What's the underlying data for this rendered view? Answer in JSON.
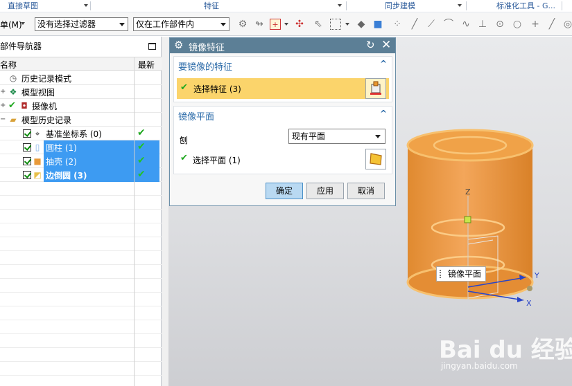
{
  "ribbon": {
    "groups": [
      "直接草图",
      "特征",
      "同步建模",
      "标准化工具 - G..."
    ]
  },
  "toolbar": {
    "menu_label": "单(M)",
    "filter_value": "没有选择过滤器",
    "scope_value": "仅在工作部件内"
  },
  "navigator": {
    "title": "部件导航器",
    "col_name": "名称",
    "col_latest": "最新",
    "rows": [
      {
        "label": "历史记录模式"
      },
      {
        "label": "模型视图"
      },
      {
        "label": "摄像机"
      },
      {
        "label": "模型历史记录"
      },
      {
        "label": "基准坐标系 (0)"
      },
      {
        "label": "圆柱 (1)"
      },
      {
        "label": "抽壳 (2)"
      },
      {
        "label": "边倒圆 (3)"
      }
    ]
  },
  "dialog": {
    "title": "镜像特征",
    "section_features": {
      "title": "要镜像的特征",
      "select_label": "选择特征 (3)"
    },
    "section_plane": {
      "title": "镜像平面",
      "orient_label": "刨",
      "plane_value": "现有平面",
      "select_label": "选择平面 (1)"
    },
    "buttons": {
      "ok": "确定",
      "apply": "应用",
      "cancel": "取消"
    }
  },
  "viewport": {
    "tooltip": "镜像平面",
    "axis_z": "Z",
    "axis_y": "Y",
    "axis_x": "X"
  },
  "watermark": {
    "main": "Bai du 经验",
    "sub": "jingyan.baidu.com"
  },
  "colors": {
    "selection_blue": "#3d9bf2",
    "highlight_yellow": "#fbd46b",
    "dialog_title": "#5c7f96",
    "cylinder_orange": "#f0a248"
  }
}
